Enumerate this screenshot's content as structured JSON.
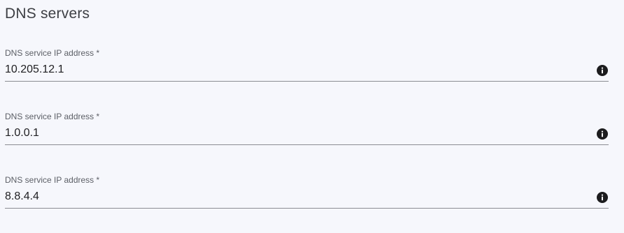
{
  "section": {
    "title": "DNS servers"
  },
  "dns_fields": [
    {
      "label": "DNS service IP address *",
      "value": "10.205.12.1",
      "icon": "info-icon"
    },
    {
      "label": "DNS service IP address *",
      "value": "1.0.0.1",
      "icon": "info-icon"
    },
    {
      "label": "DNS service IP address *",
      "value": "8.8.4.4",
      "icon": "info-icon"
    }
  ]
}
